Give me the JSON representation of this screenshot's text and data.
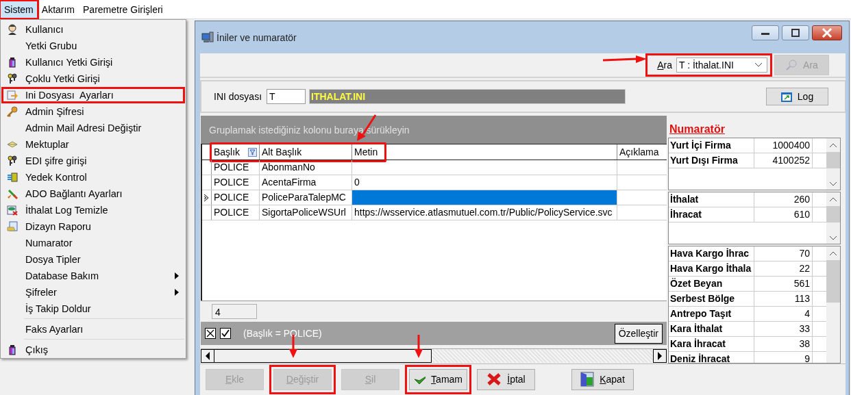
{
  "menubar": [
    {
      "label": "Sistem",
      "selected": true,
      "highlighted": true
    },
    {
      "label": "Aktarım",
      "selected": false,
      "highlighted": false
    },
    {
      "label": "Paremetre Girişleri",
      "selected": false,
      "highlighted": false
    }
  ],
  "menu": {
    "sections": [
      {
        "items": [
          {
            "label": "Kullanıcı",
            "submenu": false,
            "highlighted": false
          },
          {
            "label": "Yetki Grubu",
            "submenu": false,
            "highlighted": false
          },
          {
            "label": "Kullanıcı Yetki Girişi",
            "submenu": false,
            "highlighted": false
          },
          {
            "label": "Çoklu Yetki Girişi",
            "submenu": false,
            "highlighted": false
          },
          {
            "label": "Ini Dosyası  Ayarları",
            "submenu": false,
            "highlighted": true
          },
          {
            "label": "Admin Şifresi",
            "submenu": false,
            "highlighted": false
          },
          {
            "label": "Admin Mail Adresi Değiştir",
            "submenu": false,
            "highlighted": false
          },
          {
            "label": "Mektuplar",
            "submenu": false,
            "highlighted": false
          },
          {
            "label": "EDI şifre girişi",
            "submenu": false,
            "highlighted": false
          },
          {
            "label": "Yedek Kontrol",
            "submenu": false,
            "highlighted": false
          },
          {
            "label": "ADO Bağlantı Ayarları",
            "submenu": false,
            "highlighted": false
          },
          {
            "label": "İthalat Log Temizle",
            "submenu": false,
            "highlighted": false
          },
          {
            "label": "Dizayn Raporu",
            "submenu": false,
            "highlighted": false
          },
          {
            "label": "Numarator",
            "submenu": false,
            "highlighted": false
          },
          {
            "label": "Dosya Tipler",
            "submenu": false,
            "highlighted": false
          },
          {
            "label": "Database Bakım",
            "submenu": true,
            "highlighted": false
          },
          {
            "label": "Şifreler",
            "submenu": true,
            "highlighted": false
          },
          {
            "label": "İş Takip Doldur",
            "submenu": false,
            "highlighted": false
          }
        ]
      },
      {
        "items": [
          {
            "label": "Faks Ayarları",
            "submenu": false,
            "highlighted": false
          }
        ]
      },
      {
        "items": [
          {
            "label": "Çıkış",
            "submenu": false,
            "highlighted": false
          }
        ]
      }
    ]
  },
  "window": {
    "title": "İniler ve numaratör"
  },
  "search": {
    "label": "Ara",
    "value": "T : İthalat.INI",
    "button": "Ara",
    "button_disabled": true,
    "highlighted": true
  },
  "ini": {
    "label": "INI dosyası",
    "code": "T",
    "name": "ITHALAT.INI",
    "log_button": "Log"
  },
  "grid": {
    "group_hint": "Gruplamak istediğiniz kolonu buraya sürükleyin",
    "columns": [
      {
        "label": "Başlık",
        "filter": true
      },
      {
        "label": "Alt Başlık",
        "filter": false
      },
      {
        "label": "Metin",
        "filter": false
      },
      {
        "label": "Açıklama",
        "filter": false
      }
    ],
    "header_highlighted": true,
    "rows": [
      {
        "cells": [
          "POLICE",
          "AbonmanNo",
          "",
          ""
        ],
        "current": false
      },
      {
        "cells": [
          "POLICE",
          "AcentaFirma",
          "0",
          ""
        ],
        "current": false
      },
      {
        "cells": [
          "POLICE",
          "PoliceParaTalepMC",
          "",
          ""
        ],
        "current": true
      },
      {
        "cells": [
          "POLICE",
          "SigortaPoliceWSUrl",
          "https://wsservice.atlasmutuel.com.tr/Public/PolicyService.svc",
          ""
        ],
        "current": false
      }
    ],
    "count": "4",
    "filter": {
      "enabled": true,
      "text": "(Başlık = POLICE)",
      "customize": "Özelleştir"
    }
  },
  "numerator": {
    "title": "Numaratör",
    "tables": [
      {
        "rows": [
          {
            "name": "Yurt İçi Firma",
            "value": "1000400"
          },
          {
            "name": "Yurt Dışı Firma",
            "value": "4100252"
          }
        ]
      },
      {
        "rows": [
          {
            "name": "İthalat",
            "value": "260"
          },
          {
            "name": "İhracat",
            "value": "610"
          }
        ]
      },
      {
        "rows": [
          {
            "name": "Hava Kargo İhrac",
            "value": "70"
          },
          {
            "name": "Hava Kargo İthala",
            "value": "22"
          },
          {
            "name": "Özet Beyan",
            "value": "561"
          },
          {
            "name": "Serbest Bölge",
            "value": "113"
          },
          {
            "name": "Antrepo Taşıt",
            "value": "4"
          },
          {
            "name": "Kara İthalat",
            "value": "33"
          },
          {
            "name": "Kara İhracat",
            "value": "38"
          },
          {
            "name": "Deniz İhracat",
            "value": "9"
          }
        ]
      }
    ]
  },
  "buttons": [
    {
      "label": "Ekle",
      "disabled": true,
      "highlighted": false
    },
    {
      "label": "Değiştir",
      "disabled": true,
      "highlighted": true
    },
    {
      "label": "Sil",
      "disabled": true,
      "highlighted": false
    },
    {
      "label": "Tamam",
      "disabled": false,
      "highlighted": true
    },
    {
      "label": "İptal",
      "disabled": false,
      "highlighted": false
    }
  ],
  "close_button": {
    "label": "Kapat",
    "disabled": false
  }
}
